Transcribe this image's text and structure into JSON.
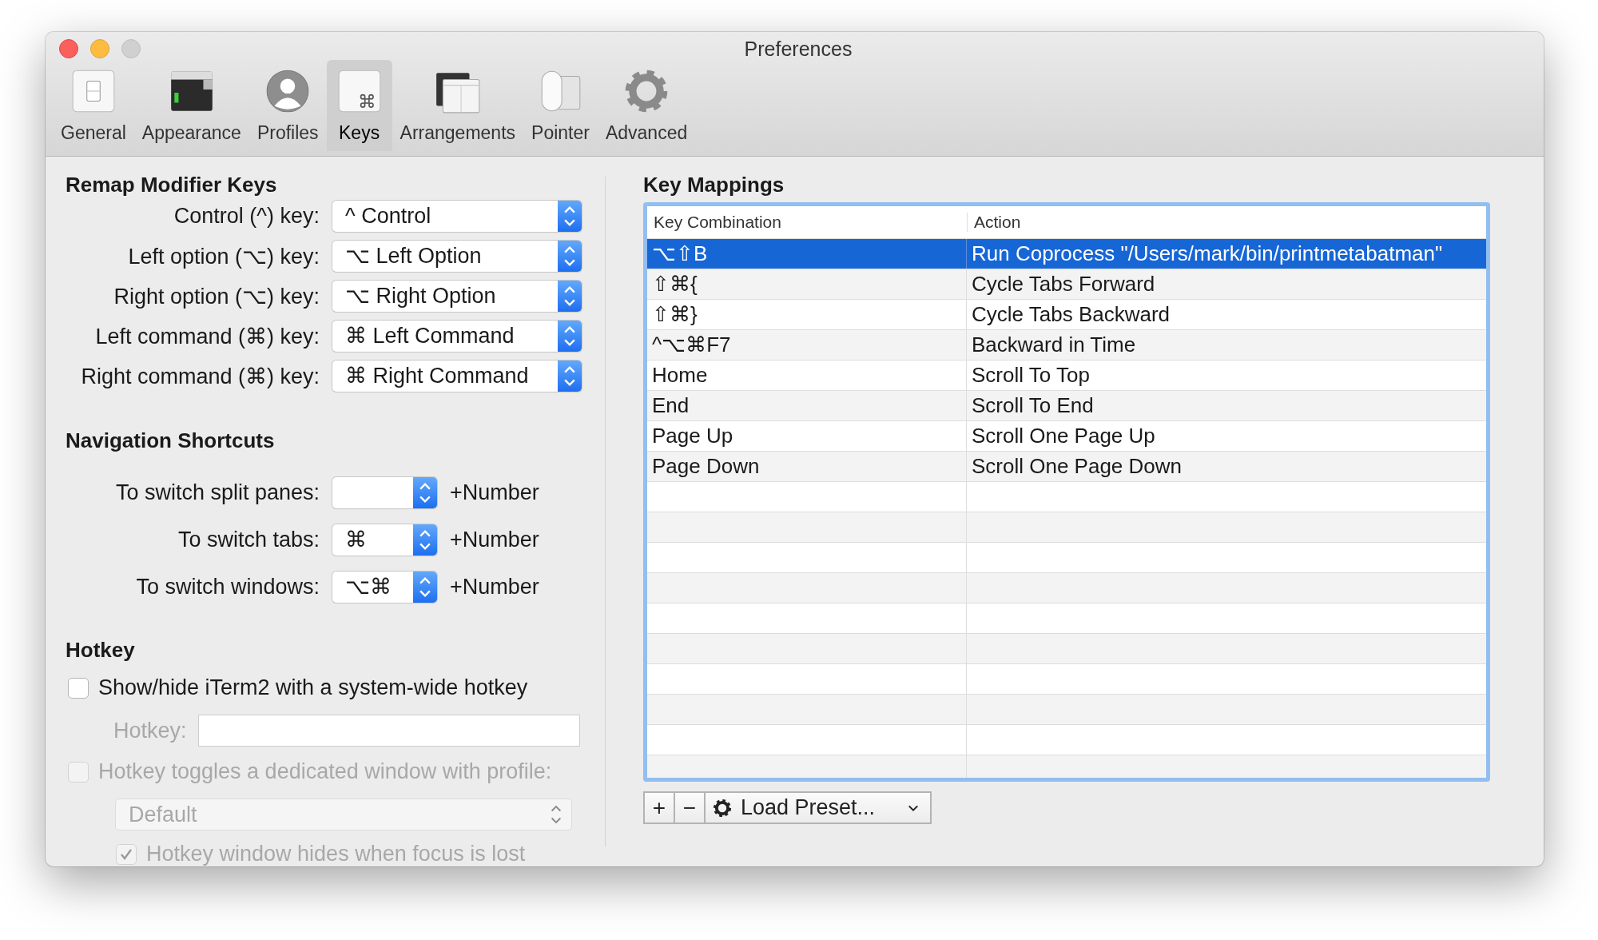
{
  "window": {
    "title": "Preferences"
  },
  "toolbar": [
    {
      "label": "General",
      "selected": false
    },
    {
      "label": "Appearance",
      "selected": false
    },
    {
      "label": "Profiles",
      "selected": false
    },
    {
      "label": "Keys",
      "selected": true
    },
    {
      "label": "Arrangements",
      "selected": false
    },
    {
      "label": "Pointer",
      "selected": false
    },
    {
      "label": "Advanced",
      "selected": false
    }
  ],
  "remap": {
    "title": "Remap Modifier Keys",
    "rows": [
      {
        "label": "Control (^) key:",
        "value": "^ Control"
      },
      {
        "label": "Left option (⌥) key:",
        "value": "⌥ Left Option"
      },
      {
        "label": "Right option (⌥) key:",
        "value": "⌥ Right Option"
      },
      {
        "label": "Left command (⌘) key:",
        "value": "⌘ Left Command"
      },
      {
        "label": "Right command (⌘) key:",
        "value": "⌘ Right Command"
      }
    ]
  },
  "navigation": {
    "title": "Navigation Shortcuts",
    "rows": [
      {
        "label": "To switch split panes:",
        "value": "",
        "suffix": "+Number"
      },
      {
        "label": "To switch tabs:",
        "value": "⌘",
        "suffix": "+Number"
      },
      {
        "label": "To switch windows:",
        "value": "⌥⌘",
        "suffix": "+Number"
      }
    ]
  },
  "hotkey": {
    "title": "Hotkey",
    "show_hide": {
      "label": "Show/hide iTerm2 with a system-wide hotkey",
      "checked": false,
      "disabled": false
    },
    "hotkey_field": {
      "label": "Hotkey:",
      "disabled": true
    },
    "dedicated": {
      "label": "Hotkey toggles a dedicated window with profile:",
      "checked": false,
      "disabled": true
    },
    "profile": {
      "value": "Default",
      "disabled": true
    },
    "hides": {
      "label": "Hotkey window hides when focus is lost",
      "checked": true,
      "disabled": true
    }
  },
  "key_mappings": {
    "title": "Key Mappings",
    "columns": [
      "Key Combination",
      "Action"
    ],
    "rows": [
      {
        "key": "⌥⇧B",
        "action": "Run Coprocess \"/Users/mark/bin/printmetabatman\"",
        "selected": true
      },
      {
        "key": "⇧⌘{",
        "action": "Cycle Tabs Forward",
        "selected": false
      },
      {
        "key": "⇧⌘}",
        "action": "Cycle Tabs Backward",
        "selected": false
      },
      {
        "key": "^⌥⌘F7",
        "action": "Backward in Time",
        "selected": false
      },
      {
        "key": "Home",
        "action": "Scroll To Top",
        "selected": false
      },
      {
        "key": "End",
        "action": "Scroll To End",
        "selected": false
      },
      {
        "key": "Page Up",
        "action": "Scroll One Page Up",
        "selected": false
      },
      {
        "key": "Page Down",
        "action": "Scroll One Page Down",
        "selected": false
      }
    ]
  },
  "buttons": {
    "add": "+",
    "remove": "−",
    "load_preset": "Load Preset..."
  }
}
